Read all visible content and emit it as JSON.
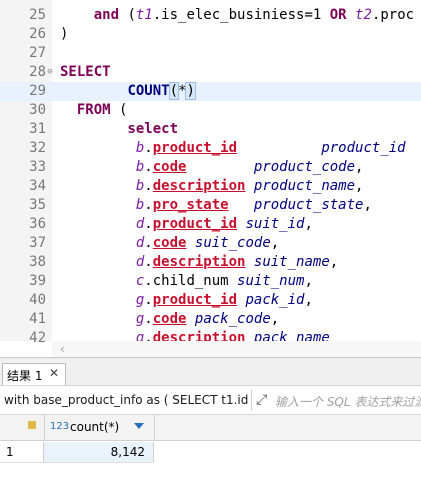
{
  "editor": {
    "lines": [
      {
        "n": "25",
        "tokens": [
          [
            "kw",
            "    and "
          ],
          [
            "plain",
            "("
          ],
          [
            "al",
            "t1"
          ],
          [
            "plain",
            ".is_elec_businiess=1 "
          ],
          [
            "kw",
            "OR "
          ],
          [
            "al",
            "t2"
          ],
          [
            "plain",
            ".proc"
          ]
        ]
      },
      {
        "n": "26",
        "tokens": [
          [
            "plain",
            ")"
          ]
        ]
      },
      {
        "n": "27",
        "tokens": []
      },
      {
        "n": "28",
        "fold": "⊖",
        "tokens": [
          [
            "kw",
            "SELECT"
          ]
        ]
      },
      {
        "n": "29",
        "hl": true,
        "tokens": [
          [
            "plain",
            "        "
          ],
          [
            "fn",
            "COUNT"
          ],
          [
            "cur",
            "("
          ],
          [
            "plain",
            "*"
          ],
          [
            "cur",
            ")"
          ]
        ]
      },
      {
        "n": "30",
        "tokens": [
          [
            "kw",
            "  FROM "
          ],
          [
            "plain",
            "("
          ]
        ]
      },
      {
        "n": "31",
        "tokens": [
          [
            "kw",
            "        select"
          ]
        ]
      },
      {
        "n": "32",
        "tokens": [
          [
            "plain",
            "         "
          ],
          [
            "al",
            "b"
          ],
          [
            "plain",
            "."
          ],
          [
            "col",
            "product_id"
          ],
          [
            "plain",
            "          "
          ],
          [
            "id",
            "product_id"
          ]
        ]
      },
      {
        "n": "33",
        "tokens": [
          [
            "plain",
            "         "
          ],
          [
            "al",
            "b"
          ],
          [
            "plain",
            "."
          ],
          [
            "col",
            "code"
          ],
          [
            "plain",
            "        "
          ],
          [
            "id",
            "product_code"
          ],
          [
            "plain",
            ","
          ]
        ]
      },
      {
        "n": "34",
        "tokens": [
          [
            "plain",
            "         "
          ],
          [
            "al",
            "b"
          ],
          [
            "plain",
            "."
          ],
          [
            "col",
            "description"
          ],
          [
            "plain",
            " "
          ],
          [
            "id",
            "product_name"
          ],
          [
            "plain",
            ","
          ]
        ]
      },
      {
        "n": "35",
        "tokens": [
          [
            "plain",
            "         "
          ],
          [
            "al",
            "b"
          ],
          [
            "plain",
            "."
          ],
          [
            "col",
            "pro_state"
          ],
          [
            "plain",
            "   "
          ],
          [
            "id",
            "product_state"
          ],
          [
            "plain",
            ","
          ]
        ]
      },
      {
        "n": "36",
        "tokens": [
          [
            "plain",
            "         "
          ],
          [
            "al",
            "d"
          ],
          [
            "plain",
            "."
          ],
          [
            "col",
            "product_id"
          ],
          [
            "plain",
            " "
          ],
          [
            "id",
            "suit_id"
          ],
          [
            "plain",
            ","
          ]
        ]
      },
      {
        "n": "37",
        "tokens": [
          [
            "plain",
            "         "
          ],
          [
            "al",
            "d"
          ],
          [
            "plain",
            "."
          ],
          [
            "col",
            "code"
          ],
          [
            "plain",
            " "
          ],
          [
            "id",
            "suit_code"
          ],
          [
            "plain",
            ","
          ]
        ]
      },
      {
        "n": "38",
        "tokens": [
          [
            "plain",
            "         "
          ],
          [
            "al",
            "d"
          ],
          [
            "plain",
            "."
          ],
          [
            "col",
            "description"
          ],
          [
            "plain",
            " "
          ],
          [
            "id",
            "suit_name"
          ],
          [
            "plain",
            ","
          ]
        ]
      },
      {
        "n": "39",
        "tokens": [
          [
            "plain",
            "         "
          ],
          [
            "al",
            "c"
          ],
          [
            "plain",
            ".child_num "
          ],
          [
            "id",
            "suit_num"
          ],
          [
            "plain",
            ","
          ]
        ]
      },
      {
        "n": "40",
        "tokens": [
          [
            "plain",
            "         "
          ],
          [
            "al",
            "g"
          ],
          [
            "plain",
            "."
          ],
          [
            "col",
            "product_id"
          ],
          [
            "plain",
            " "
          ],
          [
            "id",
            "pack_id"
          ],
          [
            "plain",
            ","
          ]
        ]
      },
      {
        "n": "41",
        "tokens": [
          [
            "plain",
            "         "
          ],
          [
            "al",
            "g"
          ],
          [
            "plain",
            "."
          ],
          [
            "col",
            "code"
          ],
          [
            "plain",
            " "
          ],
          [
            "id",
            "pack_code"
          ],
          [
            "plain",
            ","
          ]
        ]
      },
      {
        "n": "42",
        "tokens": [
          [
            "plain",
            "         "
          ],
          [
            "al",
            "g"
          ],
          [
            "plain",
            "."
          ],
          [
            "col",
            "description"
          ],
          [
            "plain",
            " "
          ],
          [
            "id",
            "pack_name"
          ]
        ]
      }
    ]
  },
  "results": {
    "tab_label": "结果 1",
    "tab_close": "✕",
    "query_text": "with base_product_info as ( SELECT t1.id a",
    "filter_placeholder": "输入一个 SQL 表达式来过滤",
    "filter_icon": "filter-expand-icon",
    "columns": [
      {
        "type_badge": "123",
        "name": "count(*)"
      }
    ],
    "rows": [
      {
        "num": "1",
        "values": [
          "8,142"
        ]
      }
    ]
  },
  "colors": {
    "keyword": "#7f0055",
    "column": "#c8102e",
    "alias": "#7a1fa0",
    "highlight_line": "#e8f2fe",
    "selected_cell": "#eaf2fb"
  }
}
